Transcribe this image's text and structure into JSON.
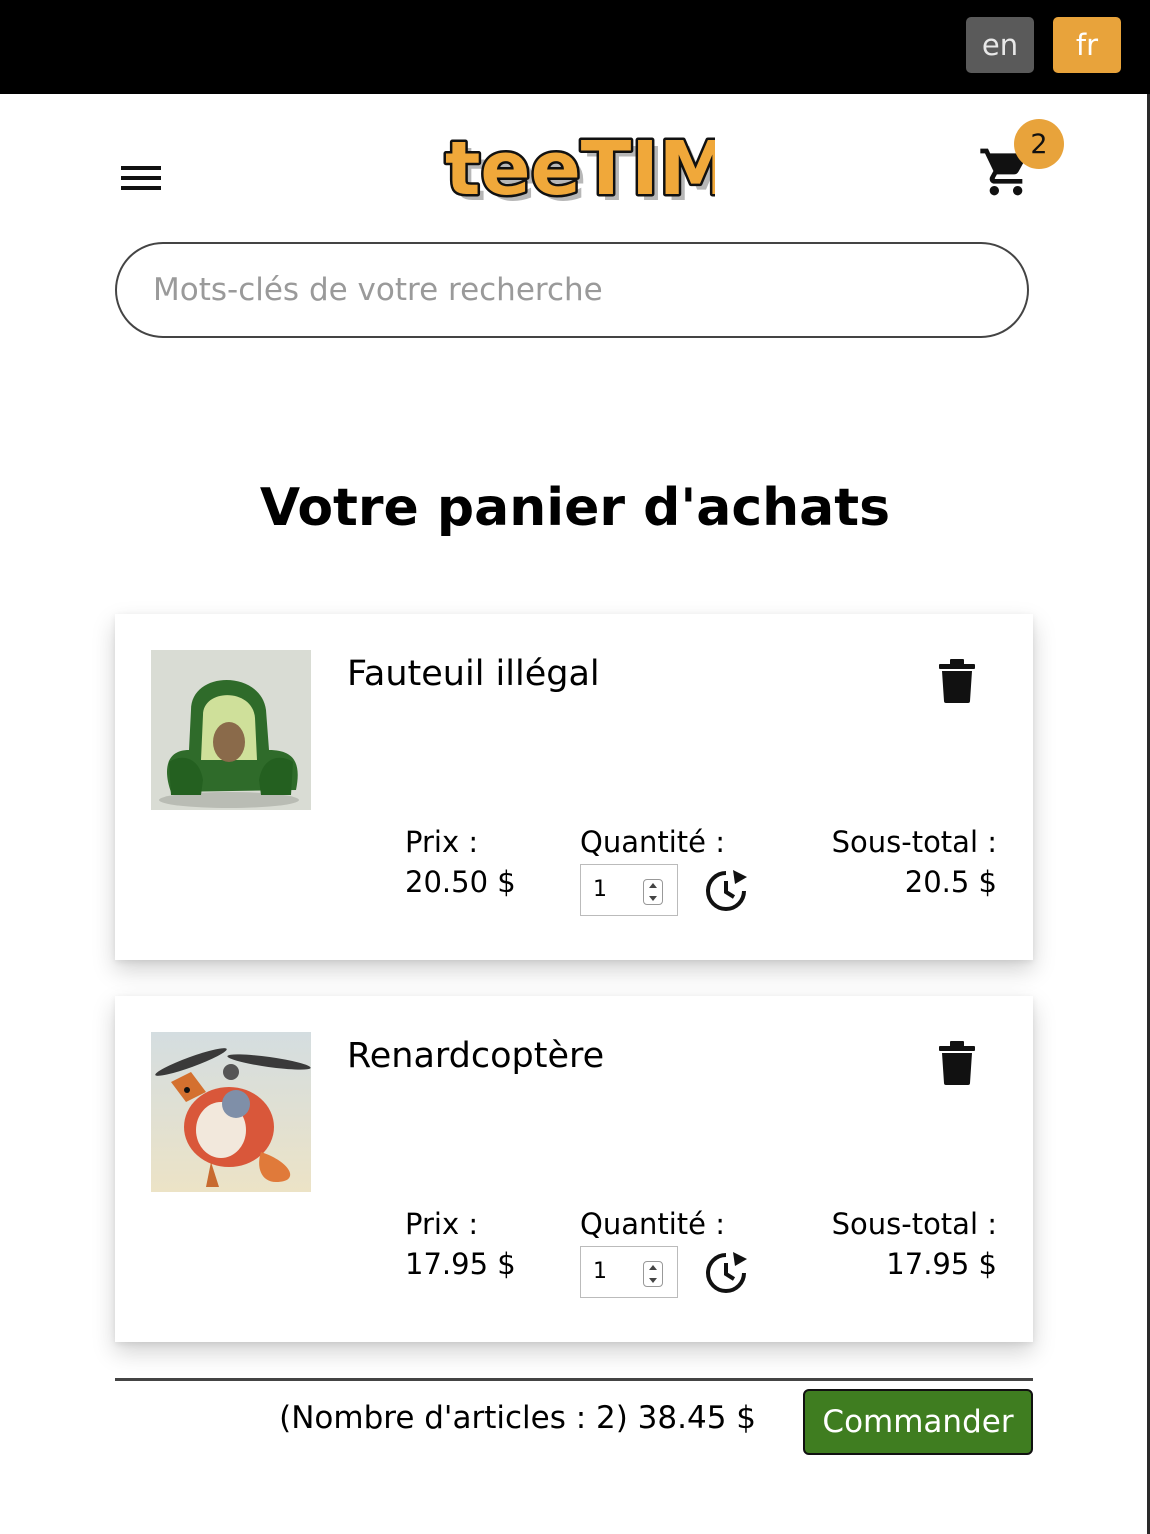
{
  "topbar": {
    "languages": [
      {
        "label": "en",
        "active": false
      },
      {
        "label": "fr",
        "active": true
      }
    ]
  },
  "header": {
    "logo_text": "teeTIM",
    "cart_count": "2"
  },
  "search": {
    "placeholder": "Mots-clés de votre recherche",
    "value": ""
  },
  "page_title": "Votre panier d'achats",
  "labels": {
    "price": "Prix :",
    "quantity": "Quantité :",
    "subtotal": "Sous-total :"
  },
  "items": [
    {
      "name": "Fauteuil illégal",
      "image": "avocado-armchair",
      "price": "20.50 $",
      "quantity": "1",
      "subtotal": "20.5 $"
    },
    {
      "name": "Renardcoptère",
      "image": "fox-helicopter",
      "price": "17.95 $",
      "quantity": "1",
      "subtotal": "17.95 $"
    }
  ],
  "summary": {
    "total_text": "(Nombre d'articles : 2) 38.45 $",
    "order_button": "Commander"
  },
  "colors": {
    "accent": "#e8a33b",
    "order_button": "#3f7d20",
    "topbar": "#000000"
  }
}
